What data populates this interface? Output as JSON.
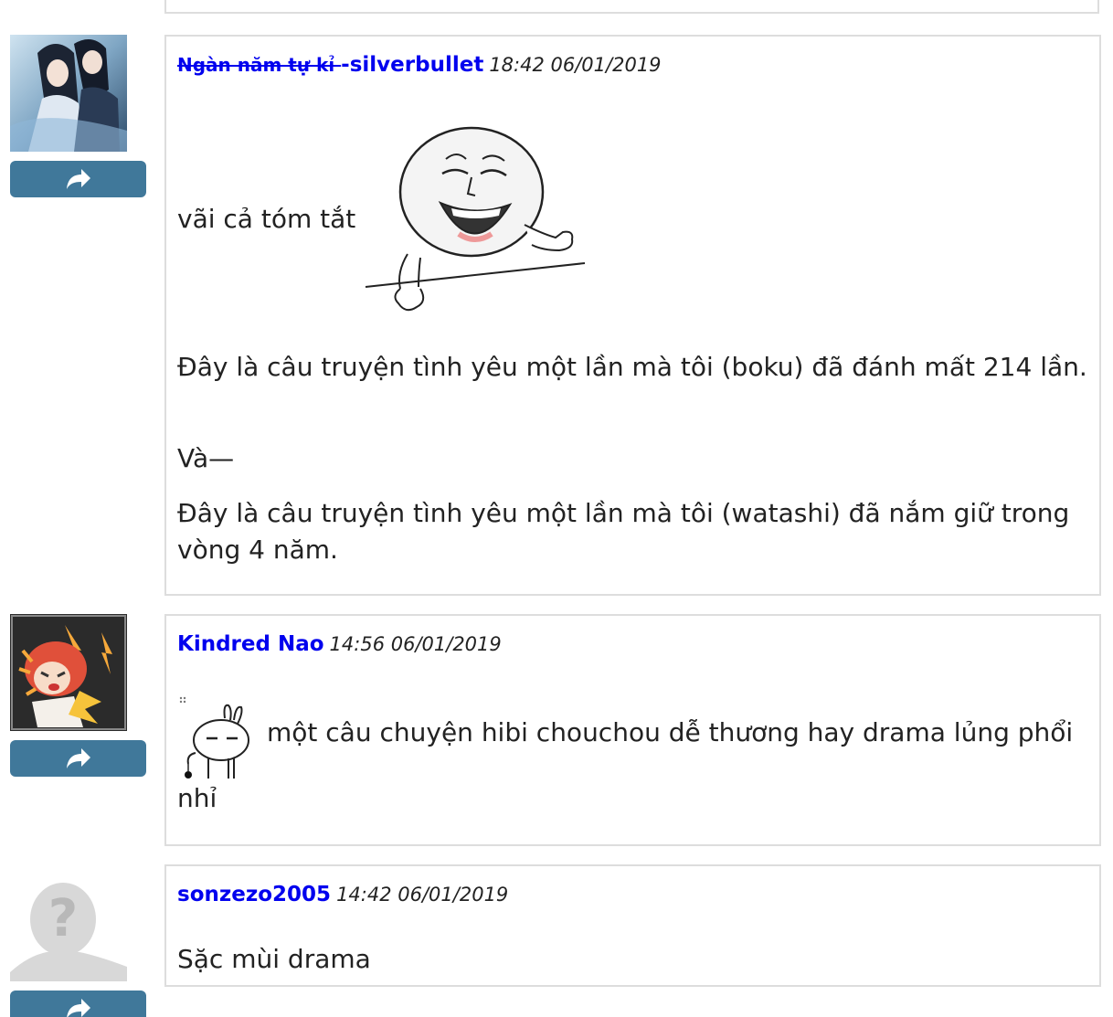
{
  "comments": [
    {
      "username_strike": "Ngàn năm tự kỉ ",
      "username": "-silverbullet",
      "time": "18:42 06/01/2019",
      "text_before_sticker": "vãi cả tóm tắt",
      "paragraphs": [
        "Đây là câu truyện tình yêu một lần mà tôi (boku) đã đánh mất 214 lần.",
        "Và—",
        "Đây là câu truyện tình yêu một lần mà tôi (watashi) đã nắm giữ trong vòng 4 năm."
      ],
      "avatar_icon": "anime-couple-avatar",
      "sticker_icon": "laughing-meme-face-sticker"
    },
    {
      "username": "Kindred Nao",
      "time": "14:56 06/01/2019",
      "text_line1": "một câu chuyện hibi chouchou dễ thương hay drama lủng phổi",
      "text_line2": "nhỉ",
      "avatar_icon": "anime-girl-avatar",
      "sticker_icon": "rabbit-emoticon-sticker"
    },
    {
      "username": "sonzezo2005",
      "time": "14:42 06/01/2019",
      "text": "Sặc mùi drama",
      "avatar_icon": "default-user-avatar"
    }
  ],
  "share_icon": "share-arrow-icon",
  "colors": {
    "username": "#0000ee",
    "share_button": "#40789a",
    "border": "#dddddd"
  }
}
